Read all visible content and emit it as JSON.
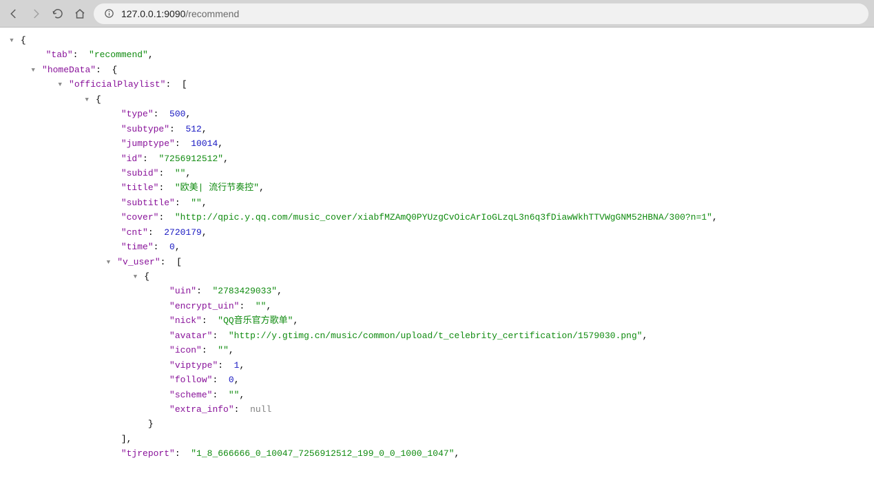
{
  "browser": {
    "url_host": "127.0.0.1:9090",
    "url_path": "/recommend"
  },
  "json": {
    "tab": {
      "key": "\"tab\"",
      "value": "\"recommend\""
    },
    "homeData": {
      "key": "\"homeData\""
    },
    "officialPlaylist": {
      "key": "\"officialPlaylist\""
    },
    "type": {
      "key": "\"type\"",
      "value": "500"
    },
    "subtype": {
      "key": "\"subtype\"",
      "value": "512"
    },
    "jumptype": {
      "key": "\"jumptype\"",
      "value": "10014"
    },
    "id": {
      "key": "\"id\"",
      "value": "\"7256912512\""
    },
    "subid": {
      "key": "\"subid\"",
      "value": "\"\""
    },
    "title": {
      "key": "\"title\"",
      "value": "\"欧美| 流行节奏控\""
    },
    "subtitle": {
      "key": "\"subtitle\"",
      "value": "\"\""
    },
    "cover": {
      "key": "\"cover\"",
      "value": "\"http://qpic.y.qq.com/music_cover/xiabfMZAmQ0PYUzgCvOicArIoGLzqL3n6q3fDiawWkhTTVWgGNM52HBNA/300?n=1\""
    },
    "cnt": {
      "key": "\"cnt\"",
      "value": "2720179"
    },
    "time": {
      "key": "\"time\"",
      "value": "0"
    },
    "v_user": {
      "key": "\"v_user\""
    },
    "uin": {
      "key": "\"uin\"",
      "value": "\"2783429033\""
    },
    "encrypt_uin": {
      "key": "\"encrypt_uin\"",
      "value": "\"\""
    },
    "nick": {
      "key": "\"nick\"",
      "value": "\"QQ音乐官方歌单\""
    },
    "avatar": {
      "key": "\"avatar\"",
      "value": "\"http://y.gtimg.cn/music/common/upload/t_celebrity_certification/1579030.png\""
    },
    "icon": {
      "key": "\"icon\"",
      "value": "\"\""
    },
    "viptype": {
      "key": "\"viptype\"",
      "value": "1"
    },
    "follow": {
      "key": "\"follow\"",
      "value": "0"
    },
    "scheme": {
      "key": "\"scheme\"",
      "value": "\"\""
    },
    "extra_info": {
      "key": "\"extra_info\"",
      "value": "null"
    },
    "tjreport": {
      "key": "\"tjreport\"",
      "value": "\"1_8_666666_0_10047_7256912512_199_0_0_1000_1047\""
    }
  }
}
